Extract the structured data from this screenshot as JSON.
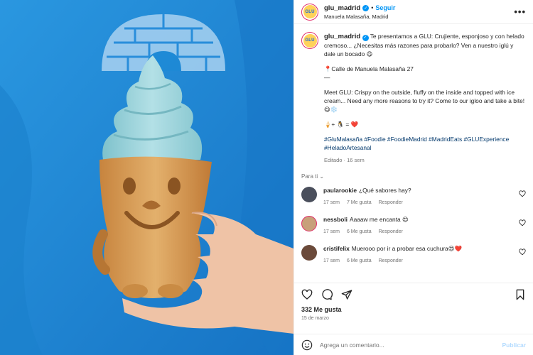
{
  "post": {
    "username": "glu_madrid",
    "logo_text": "GLU",
    "follow_label": "Seguir",
    "separator": "•",
    "location": "Manuela Malasaña, Madrid",
    "more_label": "•••"
  },
  "caption": {
    "username": "glu_madrid",
    "intro": "Te presentamos a GLU: Crujiente, esponjoso y con helado cremoso... ¿Necesitas más razones para probarlo? Ven a nuestro iglú y dale un bocado 😋",
    "address": "📍Calle de Manuela Malasaña 27",
    "divider": "—",
    "english": "Meet GLU: Crispy on the outside, fluffy on the inside and topped with ice cream... Need any more reasons to try it? Come to our igloo and take a bite! 😋❄️",
    "equation": "🍦+ 🐧 = ❤️",
    "hashtags": "#GluMalasaña #Foodie #FoodieMadrid #MadridEats #GLUExperience #HeladoArtesanal",
    "edited": "Editado · 16 sem"
  },
  "for_you_label": "Para ti ⌄",
  "comments": [
    {
      "user": "paularookie",
      "text": "¿Qué sabores hay?",
      "age": "17 sem",
      "likes": "7 Me gusta",
      "reply": "Responder",
      "avatar_color": "#4a4f5c"
    },
    {
      "user": "nessboli",
      "text": "Aaaaw me encanta 😍",
      "age": "17 sem",
      "likes": "6 Me gusta",
      "reply": "Responder",
      "avatar_color": "#c8a07a"
    },
    {
      "user": "cristifelix",
      "text": "Muerooo por ir a probar esa cuchura😍❤️",
      "age": "17 sem",
      "likes": "6 Me gusta",
      "reply": "Responder",
      "avatar_color": "#6b4a3a"
    }
  ],
  "stats": {
    "likes": "332 Me gusta",
    "date": "15 de marzo"
  },
  "comment_box": {
    "placeholder": "Agrega un comentario...",
    "publish_label": "Publicar"
  },
  "icons": [
    "verified-icon",
    "heart-icon",
    "comment-icon",
    "share-icon",
    "bookmark-icon",
    "emoji-icon",
    "more-icon"
  ],
  "colors": {
    "accent": "#0095f6",
    "background_blue": "#1e8ad6",
    "ice_cream": "#9fd3db",
    "waffle": "#d9a25c"
  }
}
